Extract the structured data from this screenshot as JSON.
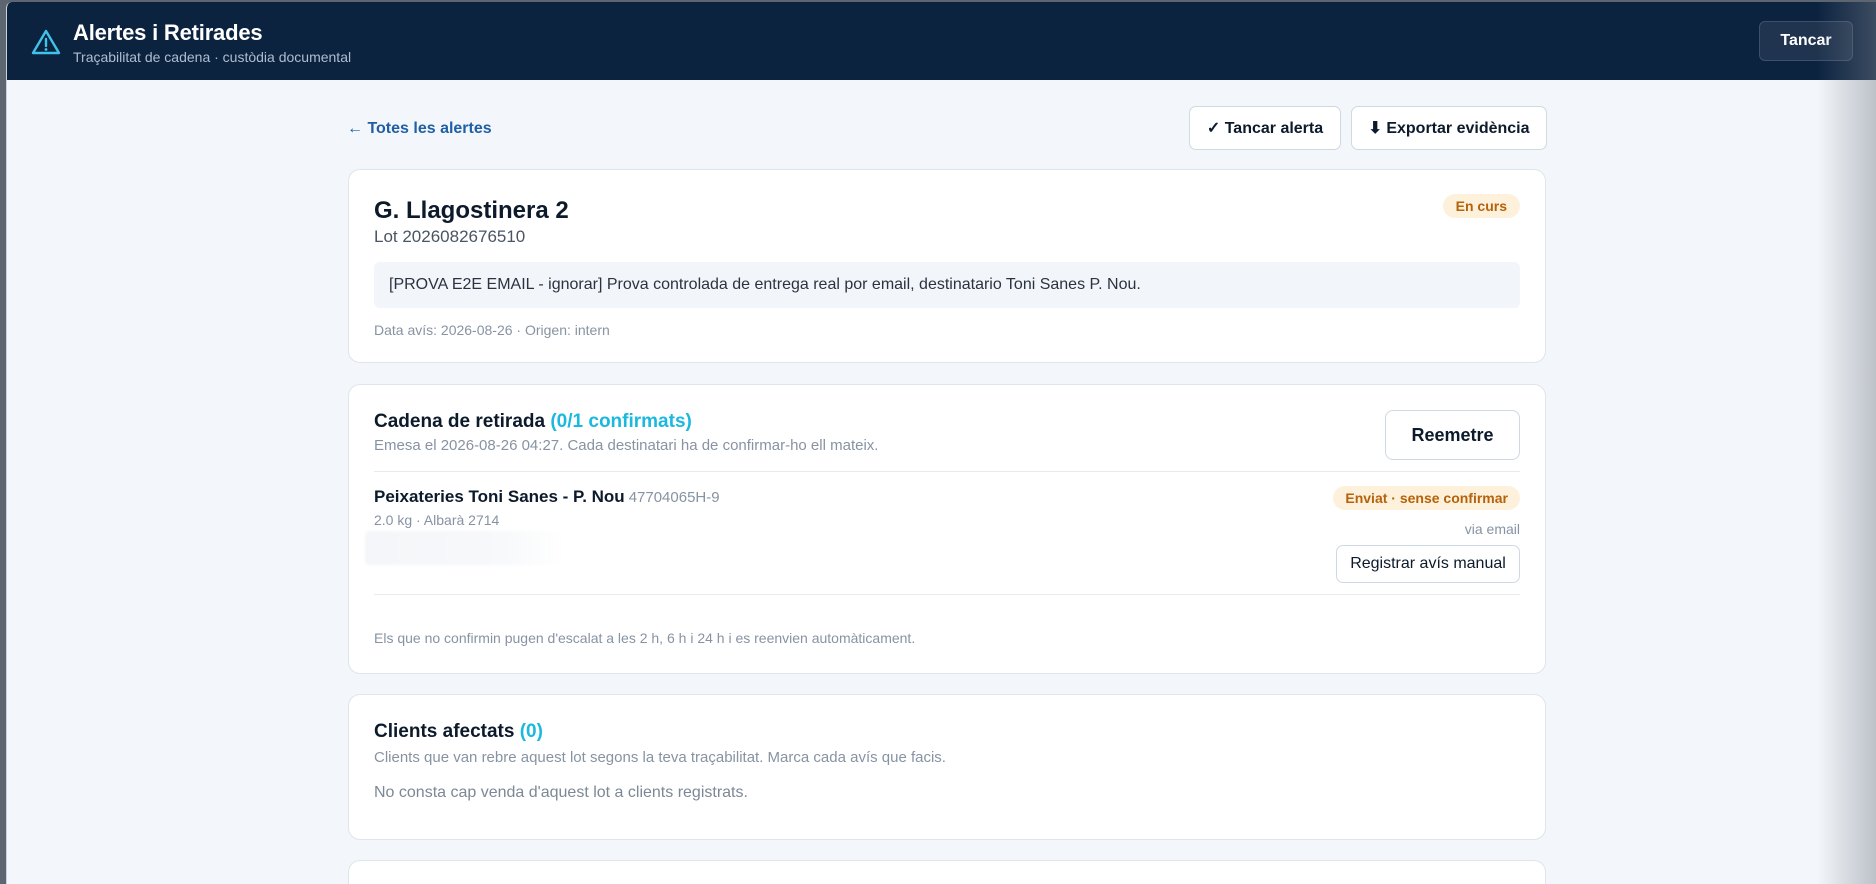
{
  "header": {
    "title": "Alertes i Retirades",
    "subtitle": "Traçabilitat de cadena · custòdia documental",
    "close_label": "Tancar"
  },
  "toolbar": {
    "back_label": "← Totes les alertes",
    "close_alert_label": "✓ Tancar alerta",
    "export_label": "⬇ Exportar evidència"
  },
  "alert": {
    "title": "G. Llagostinera 2",
    "lot": "Lot 2026082676510",
    "status": "En curs",
    "note": "[PROVA E2E EMAIL - ignorar] Prova controlada de entrega real por email, destinatario Toni Sanes P. Nou.",
    "meta": "Data avís: 2026-08-26 · Origen: intern"
  },
  "chain": {
    "title": "Cadena de retirada",
    "count": "(0/1 confirmats)",
    "subtitle": "Emesa el 2026-08-26 04:27. Cada destinatari ha de confirmar-ho ell mateix.",
    "resend_label": "Reemetre",
    "recipients": [
      {
        "name": "Peixateries Toni Sanes - P. Nou",
        "id": "47704065H-9",
        "details": "2.0 kg · Albarà 2714",
        "status": "Enviat · sense confirmar",
        "channel": "via email",
        "manual_label": "Registrar avís manual"
      }
    ],
    "footer": "Els que no confirmin pugen d'escalat a les 2 h, 6 h i 24 h i es reenvien automàticament."
  },
  "clients": {
    "title": "Clients afectats",
    "count": "(0)",
    "subtitle": "Clients que van rebre aquest lot segons la teva traçabilitat. Marca cada avís que facis.",
    "empty": "No consta cap venda d'aquest lot a clients registrats."
  },
  "colors": {
    "header_bg": "#0c2340",
    "accent": "#1bb8e0",
    "warning_badge_bg": "#fdf1dc",
    "warning_badge_text": "#b5620a"
  },
  "icons": {
    "header": "warning-triangle-icon"
  }
}
